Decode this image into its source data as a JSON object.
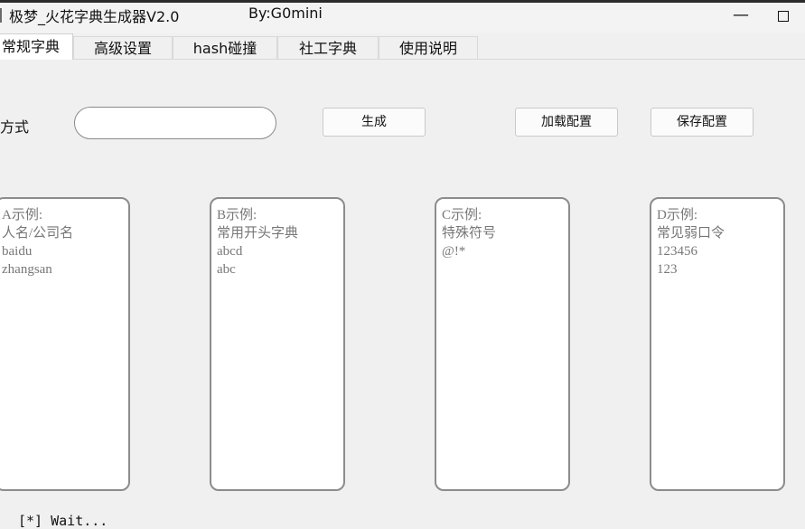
{
  "window": {
    "title": "极梦_火花字典生成器V2.0",
    "author": "By:G0mini",
    "minimize_glyph": "—"
  },
  "tabs": [
    {
      "label": "常规字典",
      "active": true
    },
    {
      "label": "高级设置",
      "active": false
    },
    {
      "label": "hash碰撞",
      "active": false
    },
    {
      "label": "社工字典",
      "active": false
    },
    {
      "label": "使用说明",
      "active": false
    }
  ],
  "form": {
    "mode_label": "组合方式",
    "mode_value": "",
    "generate_label": "生成",
    "load_label": "加载配置",
    "save_label": "保存配置"
  },
  "boxes": {
    "a": "A示例:\n人名/公司名\nbaidu\nzhangsan",
    "b": "B示例:\n常用开头字典\nabcd\nabc",
    "c": "C示例:\n特殊符号\n@!*",
    "d": "D示例:\n常见弱口令\n123456\n123"
  },
  "status": "[*] Wait..."
}
